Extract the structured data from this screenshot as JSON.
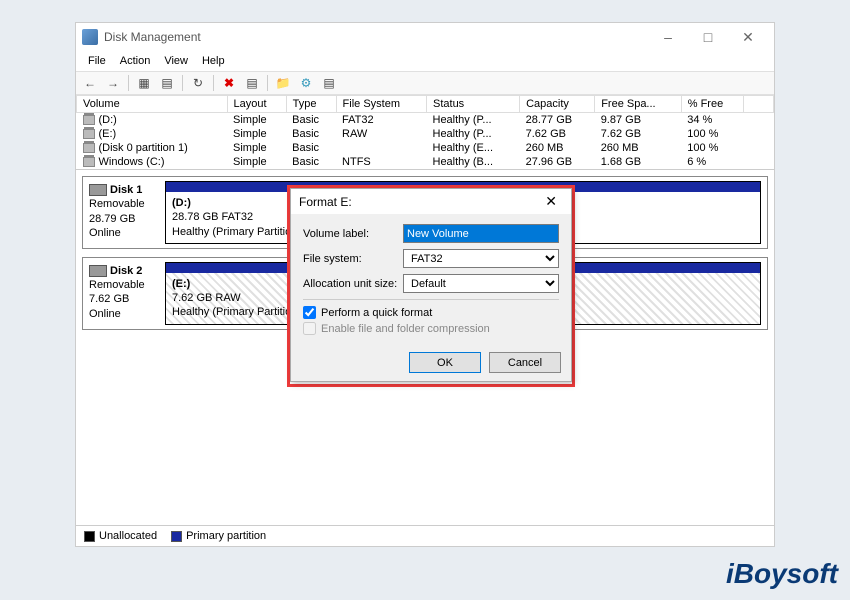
{
  "window": {
    "title": "Disk Management",
    "menu": [
      "File",
      "Action",
      "View",
      "Help"
    ]
  },
  "columns": [
    "Volume",
    "Layout",
    "Type",
    "File System",
    "Status",
    "Capacity",
    "Free Spa...",
    "% Free"
  ],
  "volumes": [
    {
      "name": "(D:)",
      "layout": "Simple",
      "type": "Basic",
      "fs": "FAT32",
      "status": "Healthy (P...",
      "cap": "28.77 GB",
      "free": "9.87 GB",
      "pct": "34 %"
    },
    {
      "name": "(E:)",
      "layout": "Simple",
      "type": "Basic",
      "fs": "RAW",
      "status": "Healthy (P...",
      "cap": "7.62 GB",
      "free": "7.62 GB",
      "pct": "100 %"
    },
    {
      "name": "(Disk 0 partition 1)",
      "layout": "Simple",
      "type": "Basic",
      "fs": "",
      "status": "Healthy (E...",
      "cap": "260 MB",
      "free": "260 MB",
      "pct": "100 %"
    },
    {
      "name": "Windows (C:)",
      "layout": "Simple",
      "type": "Basic",
      "fs": "NTFS",
      "status": "Healthy (B...",
      "cap": "27.96 GB",
      "free": "1.68 GB",
      "pct": "6 %"
    }
  ],
  "disks": [
    {
      "name": "Disk 1",
      "kind": "Removable",
      "size": "28.79 GB",
      "state": "Online",
      "part": {
        "label": "(D:)",
        "sub": "28.78 GB FAT32",
        "status": "Healthy (Primary Partition)",
        "hatch": false
      }
    },
    {
      "name": "Disk 2",
      "kind": "Removable",
      "size": "7.62 GB",
      "state": "Online",
      "part": {
        "label": "(E:)",
        "sub": "7.62 GB RAW",
        "status": "Healthy (Primary Partition)",
        "hatch": true
      }
    }
  ],
  "legend": {
    "unalloc": "Unallocated",
    "primary": "Primary partition"
  },
  "dialog": {
    "title": "Format E:",
    "fields": {
      "vol_label_lbl": "Volume label:",
      "vol_label_val": "New Volume",
      "fs_lbl": "File system:",
      "fs_val": "FAT32",
      "au_lbl": "Allocation unit size:",
      "au_val": "Default"
    },
    "quick_format": "Perform a quick format",
    "quick_checked": true,
    "compression": "Enable file and folder compression",
    "ok": "OK",
    "cancel": "Cancel"
  },
  "watermark": "iBoysoft"
}
